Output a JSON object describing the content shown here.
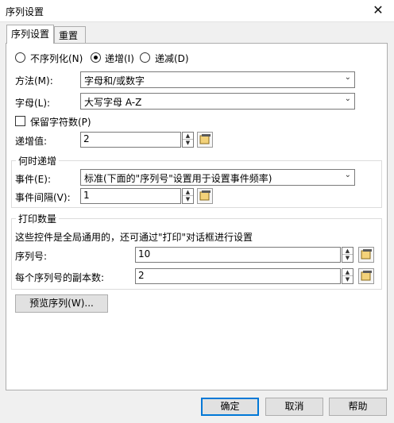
{
  "window": {
    "title": "序列设置",
    "close_glyph": "✕"
  },
  "tabs": [
    {
      "label": "序列设置",
      "active": true
    },
    {
      "label": "重置",
      "active": false
    }
  ],
  "mode": {
    "options": [
      "不序列化(N)",
      "递增(I)",
      "递减(D)"
    ],
    "selected": "递增(I)"
  },
  "method": {
    "label": "方法(M):",
    "value": "字母和/或数字"
  },
  "letters": {
    "label": "字母(L):",
    "value": "大写字母 A-Z"
  },
  "keep_chars": {
    "label": "保留字符数(P)",
    "checked": false
  },
  "increment": {
    "label": "递增值:",
    "value": "2"
  },
  "when": {
    "group_label": "何时递增",
    "event_label": "事件(E):",
    "event_value": "标准(下面的\"序列号\"设置用于设置事件频率)",
    "interval_label": "事件间隔(V):",
    "interval_value": "1"
  },
  "print_qty": {
    "group_label": "打印数量",
    "note": "这些控件是全局通用的，还可通过\"打印\"对话框进行设置",
    "serial_label": "序列号:",
    "serial_value": "10",
    "copies_label": "每个序列号的副本数:",
    "copies_value": "2"
  },
  "preview_button": "预览序列(W)...",
  "footer": {
    "ok": "确定",
    "cancel": "取消",
    "help": "帮助"
  },
  "colors": {
    "accent": "#0078d7",
    "panel": "#ffffff",
    "window": "#f0f0f0"
  }
}
